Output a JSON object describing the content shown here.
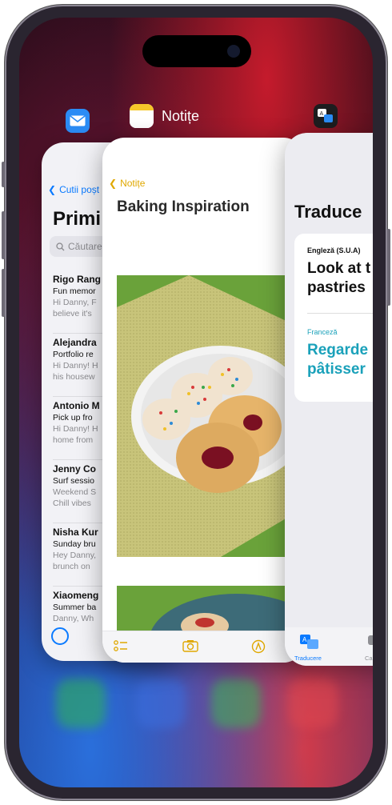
{
  "switcher": {
    "mail_card": {
      "back_label": "Cutii poșt",
      "title": "Primi",
      "search_placeholder": "Căutare",
      "messages": [
        {
          "sender": "Rigo Rang",
          "subject": "Fun memor",
          "preview1": "Hi Danny, F",
          "preview2": "believe it's"
        },
        {
          "sender": "Alejandra",
          "subject": "Portfolio re",
          "preview1": "Hi Danny! H",
          "preview2": "his housew"
        },
        {
          "sender": "Antonio M",
          "subject": "Pick up fro",
          "preview1": "Hi Danny! H",
          "preview2": "home from"
        },
        {
          "sender": "Jenny Co",
          "subject": "Surf sessio",
          "preview1": "Weekend S",
          "preview2": "Chill vibes"
        },
        {
          "sender": "Nisha Kur",
          "subject": "Sunday bru",
          "preview1": "Hey Danny,",
          "preview2": "brunch on"
        },
        {
          "sender": "Xiaomeng",
          "subject": "Summer ba",
          "preview1": "Danny, Wh",
          "preview2": ""
        }
      ]
    },
    "notes_card": {
      "app_label": "Notițe",
      "back_label": "Notițe",
      "note_title": "Baking Inspiration"
    },
    "translate_card": {
      "title": "Traduce",
      "source_lang": "Engleză (S.U.A)",
      "source_text_line1": "Look at t",
      "source_text_line2": "pastries",
      "target_lang": "Franceză",
      "target_text_line1": "Regarde",
      "target_text_line2": "pâtisser",
      "tab_translate": "Traducere",
      "tab_camera": "Ca"
    }
  },
  "colors": {
    "mail_accent": "#0a7aff",
    "notes_accent": "#e0a800",
    "translate_accent": "#1aa1ba"
  }
}
